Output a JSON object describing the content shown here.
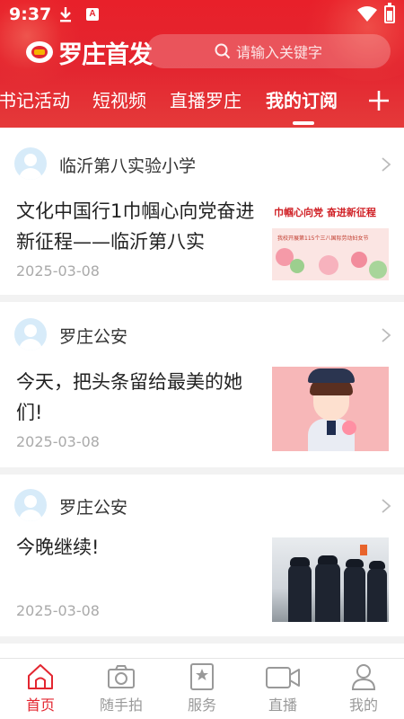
{
  "status_bar": {
    "time": "9:37",
    "notif_a": "A"
  },
  "brand": {
    "name": "罗庄首发"
  },
  "search": {
    "placeholder": "请输入关键字"
  },
  "tabs": [
    {
      "label": "书记活动"
    },
    {
      "label": "短视频"
    },
    {
      "label": "直播罗庄"
    },
    {
      "label": "我的订阅",
      "active": true
    }
  ],
  "feed": [
    {
      "source": "临沂第八实验小学",
      "title": "文化中国行1巾帼心向党奋进新征程——临沂第八实",
      "date": "2025-03-08",
      "thumb": {
        "headline": "巾帼心向党 奋进新征程",
        "subline": "我校开展第115个三八国际劳动妇女节"
      }
    },
    {
      "source": "罗庄公安",
      "title": "今天，把头条留给最美的她们!",
      "date": "2025-03-08",
      "thumb": {}
    },
    {
      "source": "罗庄公安",
      "title": "今晚继续!",
      "date": "2025-03-08",
      "thumb": {}
    }
  ],
  "bottom_nav": [
    {
      "label": "首页",
      "icon": "home-icon",
      "active": true
    },
    {
      "label": "随手拍",
      "icon": "camera-icon"
    },
    {
      "label": "服务",
      "icon": "service-icon"
    },
    {
      "label": "直播",
      "icon": "video-icon"
    },
    {
      "label": "我的",
      "icon": "user-icon"
    }
  ],
  "colors": {
    "brand_red": "#e32630",
    "inactive": "#999999",
    "date": "#aaaaaa"
  }
}
